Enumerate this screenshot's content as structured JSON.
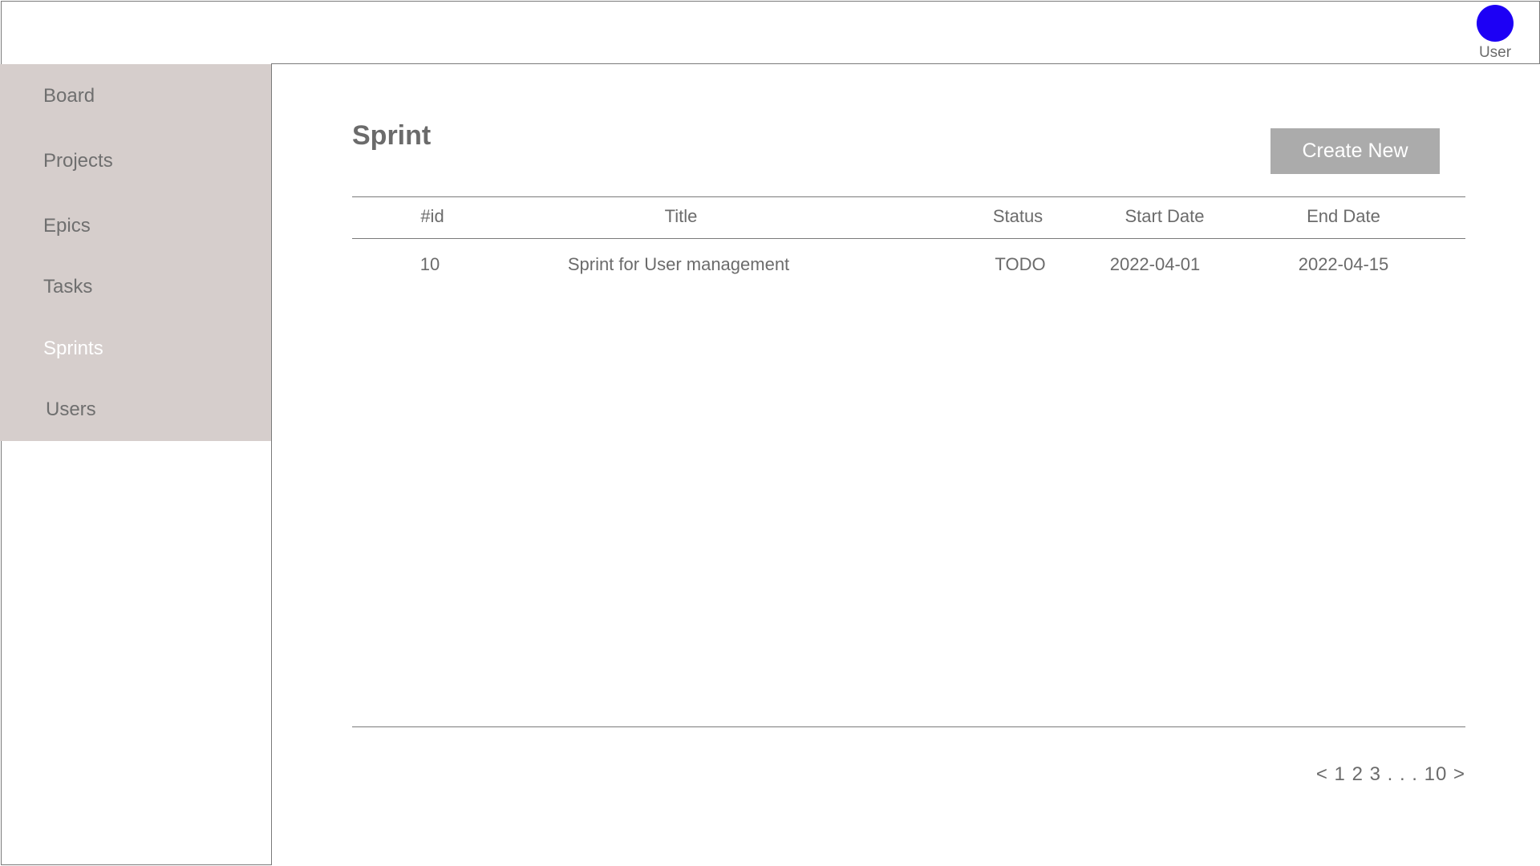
{
  "header": {
    "user_label": "User",
    "avatar_color": "#1d00f5"
  },
  "sidebar": {
    "active": "Sprints",
    "items": [
      {
        "label": "Board"
      },
      {
        "label": "Projects"
      },
      {
        "label": "Epics"
      },
      {
        "label": "Tasks"
      },
      {
        "label": "Sprints"
      },
      {
        "label": "Users"
      }
    ]
  },
  "main": {
    "title": "Sprint",
    "create_label": "Create New"
  },
  "table": {
    "columns": [
      "#id",
      "Title",
      "Status",
      "Start Date",
      "End Date"
    ],
    "rows": [
      [
        "10",
        "Sprint for User management",
        "TODO",
        "2022-04-01",
        "2022-04-15"
      ]
    ]
  },
  "pagination": {
    "text": "< 1 2 3 . . . 10 >"
  },
  "colors": {
    "sidebar_bg": "#d6cecc",
    "button_bg": "#ababab",
    "text": "#6b6b6b"
  }
}
